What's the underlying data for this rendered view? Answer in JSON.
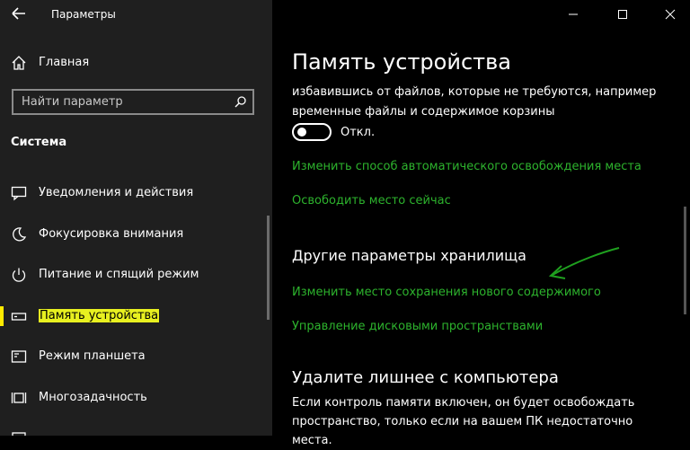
{
  "window": {
    "title": "Параметры"
  },
  "sidebar": {
    "home_label": "Главная",
    "search_placeholder": "Найти параметр",
    "section_title": "Система",
    "items": [
      {
        "label": "Уведомления и действия",
        "icon": "message-icon"
      },
      {
        "label": "Фокусировка внимания",
        "icon": "moon-icon"
      },
      {
        "label": "Питание и спящий режим",
        "icon": "power-icon"
      },
      {
        "label": "Память устройства",
        "icon": "storage-icon",
        "active": true
      },
      {
        "label": "Режим планшета",
        "icon": "tablet-icon"
      },
      {
        "label": "Многозадачность",
        "icon": "multitask-icon"
      }
    ]
  },
  "main": {
    "title": "Память устройства",
    "description": "избавившись от файлов, которые не требуются, например временные файлы и содержимое корзины",
    "toggle": {
      "state": "off",
      "label": "Откл."
    },
    "link_auto_free": "Изменить способ автоматического освобождения места",
    "link_free_now": "Освободить место сейчас",
    "other_storage_title": "Другие параметры хранилища",
    "link_change_save_location": "Изменить место сохранения нового содержимого",
    "link_manage_spaces": "Управление дисковыми пространствами",
    "remove_title": "Удалите лишнее с компьютера",
    "remove_description": "Если контроль памяти включен, он будет освобождать пространство, только если на вашем ПК недостаточно места."
  },
  "colors": {
    "accent_link": "#2db32d",
    "highlight": "#e8f020",
    "arrow": "#1fa01f"
  }
}
